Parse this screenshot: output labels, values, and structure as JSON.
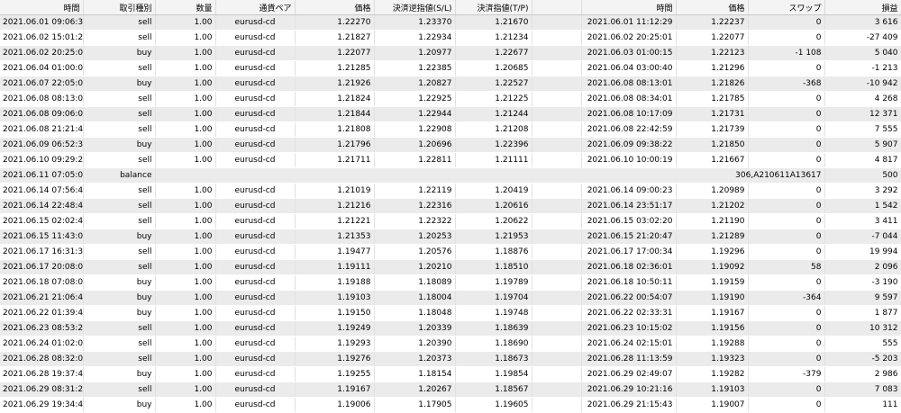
{
  "headers": [
    "時間",
    "取引種別",
    "数量",
    "通貨ペア",
    "価格",
    "決済逆指値(S/L)",
    "決済指値(T/P)",
    "",
    "時間",
    "価格",
    "スワップ",
    "損益"
  ],
  "rows": [
    {
      "time": "2021.06.01 09:06:36",
      "type": "sell",
      "lots": "1.00",
      "symbol": "eurusd-cd",
      "price": "1.22270",
      "sl": "1.23370",
      "tp": "1.21670",
      "close_time": "2021.06.01 11:12:29",
      "close_price": "1.22237",
      "swap": "0",
      "profit": "3 616"
    },
    {
      "time": "2021.06.02 15:01:24",
      "type": "sell",
      "lots": "1.00",
      "symbol": "eurusd-cd",
      "price": "1.21827",
      "sl": "1.22934",
      "tp": "1.21234",
      "close_time": "2021.06.02 20:25:01",
      "close_price": "1.22077",
      "swap": "0",
      "profit": "-27 409"
    },
    {
      "time": "2021.06.02 20:25:02",
      "type": "buy",
      "lots": "1.00",
      "symbol": "eurusd-cd",
      "price": "1.22077",
      "sl": "1.20977",
      "tp": "1.22677",
      "close_time": "2021.06.03 01:00:15",
      "close_price": "1.22123",
      "swap": "-1 108",
      "profit": "5 040"
    },
    {
      "time": "2021.06.04 01:00:07",
      "type": "sell",
      "lots": "1.00",
      "symbol": "eurusd-cd",
      "price": "1.21285",
      "sl": "1.22385",
      "tp": "1.20685",
      "close_time": "2021.06.04 03:00:40",
      "close_price": "1.21296",
      "swap": "0",
      "profit": "-1 213"
    },
    {
      "time": "2021.06.07 22:05:01",
      "type": "buy",
      "lots": "1.00",
      "symbol": "eurusd-cd",
      "price": "1.21926",
      "sl": "1.20827",
      "tp": "1.22527",
      "close_time": "2021.06.08 08:13:01",
      "close_price": "1.21826",
      "swap": "-368",
      "profit": "-10 942"
    },
    {
      "time": "2021.06.08 08:13:05",
      "type": "sell",
      "lots": "1.00",
      "symbol": "eurusd-cd",
      "price": "1.21824",
      "sl": "1.22925",
      "tp": "1.21225",
      "close_time": "2021.06.08 08:34:01",
      "close_price": "1.21785",
      "swap": "0",
      "profit": "4 268"
    },
    {
      "time": "2021.06.08 09:06:02",
      "type": "sell",
      "lots": "1.00",
      "symbol": "eurusd-cd",
      "price": "1.21844",
      "sl": "1.22944",
      "tp": "1.21244",
      "close_time": "2021.06.08 10:17:09",
      "close_price": "1.21731",
      "swap": "0",
      "profit": "12 371"
    },
    {
      "time": "2021.06.08 21:21:48",
      "type": "sell",
      "lots": "1.00",
      "symbol": "eurusd-cd",
      "price": "1.21808",
      "sl": "1.22908",
      "tp": "1.21208",
      "close_time": "2021.06.08 22:42:59",
      "close_price": "1.21739",
      "swap": "0",
      "profit": "7 555"
    },
    {
      "time": "2021.06.09 06:52:35",
      "type": "buy",
      "lots": "1.00",
      "symbol": "eurusd-cd",
      "price": "1.21796",
      "sl": "1.20696",
      "tp": "1.22396",
      "close_time": "2021.06.09 09:38:22",
      "close_price": "1.21850",
      "swap": "0",
      "profit": "5 907"
    },
    {
      "time": "2021.06.10 09:29:28",
      "type": "sell",
      "lots": "1.00",
      "symbol": "eurusd-cd",
      "price": "1.21711",
      "sl": "1.22811",
      "tp": "1.21111",
      "close_time": "2021.06.10 10:00:19",
      "close_price": "1.21667",
      "swap": "0",
      "profit": "4 817"
    },
    {
      "time": "2021.06.11 07:05:01",
      "type": "balance",
      "balance_comment": "306,A210611A13617",
      "profit": "500"
    },
    {
      "time": "2021.06.14 07:56:43",
      "type": "sell",
      "lots": "1.00",
      "symbol": "eurusd-cd",
      "price": "1.21019",
      "sl": "1.22119",
      "tp": "1.20419",
      "close_time": "2021.06.14 09:00:23",
      "close_price": "1.20989",
      "swap": "0",
      "profit": "3 292"
    },
    {
      "time": "2021.06.14 22:48:41",
      "type": "sell",
      "lots": "1.00",
      "symbol": "eurusd-cd",
      "price": "1.21216",
      "sl": "1.22316",
      "tp": "1.20616",
      "close_time": "2021.06.14 23:51:17",
      "close_price": "1.21202",
      "swap": "0",
      "profit": "1 542"
    },
    {
      "time": "2021.06.15 02:02:44",
      "type": "sell",
      "lots": "1.00",
      "symbol": "eurusd-cd",
      "price": "1.21221",
      "sl": "1.22322",
      "tp": "1.20622",
      "close_time": "2021.06.15 03:02:20",
      "close_price": "1.21190",
      "swap": "0",
      "profit": "3 411"
    },
    {
      "time": "2021.06.15 11:43:09",
      "type": "buy",
      "lots": "1.00",
      "symbol": "eurusd-cd",
      "price": "1.21353",
      "sl": "1.20253",
      "tp": "1.21953",
      "close_time": "2021.06.15 21:20:47",
      "close_price": "1.21289",
      "swap": "0",
      "profit": "-7 044"
    },
    {
      "time": "2021.06.17 16:31:37",
      "type": "sell",
      "lots": "1.00",
      "symbol": "eurusd-cd",
      "price": "1.19477",
      "sl": "1.20576",
      "tp": "1.18876",
      "close_time": "2021.06.17 17:00:34",
      "close_price": "1.19296",
      "swap": "0",
      "profit": "19 994"
    },
    {
      "time": "2021.06.17 20:08:01",
      "type": "sell",
      "lots": "1.00",
      "symbol": "eurusd-cd",
      "price": "1.19111",
      "sl": "1.20210",
      "tp": "1.18510",
      "close_time": "2021.06.18 02:36:01",
      "close_price": "1.19092",
      "swap": "58",
      "profit": "2 096"
    },
    {
      "time": "2021.06.18 07:08:03",
      "type": "buy",
      "lots": "1.00",
      "symbol": "eurusd-cd",
      "price": "1.19188",
      "sl": "1.18089",
      "tp": "1.19789",
      "close_time": "2021.06.18 10:50:11",
      "close_price": "1.19159",
      "swap": "0",
      "profit": "-3 190"
    },
    {
      "time": "2021.06.21 21:06:47",
      "type": "buy",
      "lots": "1.00",
      "symbol": "eurusd-cd",
      "price": "1.19103",
      "sl": "1.18004",
      "tp": "1.19704",
      "close_time": "2021.06.22 00:54:07",
      "close_price": "1.19190",
      "swap": "-364",
      "profit": "9 597"
    },
    {
      "time": "2021.06.22 01:39:44",
      "type": "buy",
      "lots": "1.00",
      "symbol": "eurusd-cd",
      "price": "1.19150",
      "sl": "1.18048",
      "tp": "1.19748",
      "close_time": "2021.06.22 02:33:31",
      "close_price": "1.19167",
      "swap": "0",
      "profit": "1 877"
    },
    {
      "time": "2021.06.23 08:53:22",
      "type": "sell",
      "lots": "1.00",
      "symbol": "eurusd-cd",
      "price": "1.19249",
      "sl": "1.20339",
      "tp": "1.18639",
      "close_time": "2021.06.23 10:15:02",
      "close_price": "1.19156",
      "swap": "0",
      "profit": "10 312"
    },
    {
      "time": "2021.06.24 01:02:08",
      "type": "sell",
      "lots": "1.00",
      "symbol": "eurusd-cd",
      "price": "1.19293",
      "sl": "1.20390",
      "tp": "1.18690",
      "close_time": "2021.06.24 02:15:01",
      "close_price": "1.19288",
      "swap": "0",
      "profit": "555"
    },
    {
      "time": "2021.06.28 08:32:05",
      "type": "sell",
      "lots": "1.00",
      "symbol": "eurusd-cd",
      "price": "1.19276",
      "sl": "1.20373",
      "tp": "1.18673",
      "close_time": "2021.06.28 11:13:59",
      "close_price": "1.19323",
      "swap": "0",
      "profit": "-5 203"
    },
    {
      "time": "2021.06.28 19:37:47",
      "type": "buy",
      "lots": "1.00",
      "symbol": "eurusd-cd",
      "price": "1.19255",
      "sl": "1.18154",
      "tp": "1.19854",
      "close_time": "2021.06.29 02:49:07",
      "close_price": "1.19282",
      "swap": "-379",
      "profit": "2 986"
    },
    {
      "time": "2021.06.29 08:31:22",
      "type": "sell",
      "lots": "1.00",
      "symbol": "eurusd-cd",
      "price": "1.19167",
      "sl": "1.20267",
      "tp": "1.18567",
      "close_time": "2021.06.29 10:21:16",
      "close_price": "1.19103",
      "swap": "0",
      "profit": "7 083"
    },
    {
      "time": "2021.06.29 19:34:41",
      "type": "buy",
      "lots": "1.00",
      "symbol": "eurusd-cd",
      "price": "1.19006",
      "sl": "1.17905",
      "tp": "1.19605",
      "close_time": "2021.06.29 21:15:43",
      "close_price": "1.19007",
      "swap": "0",
      "profit": "111"
    }
  ]
}
